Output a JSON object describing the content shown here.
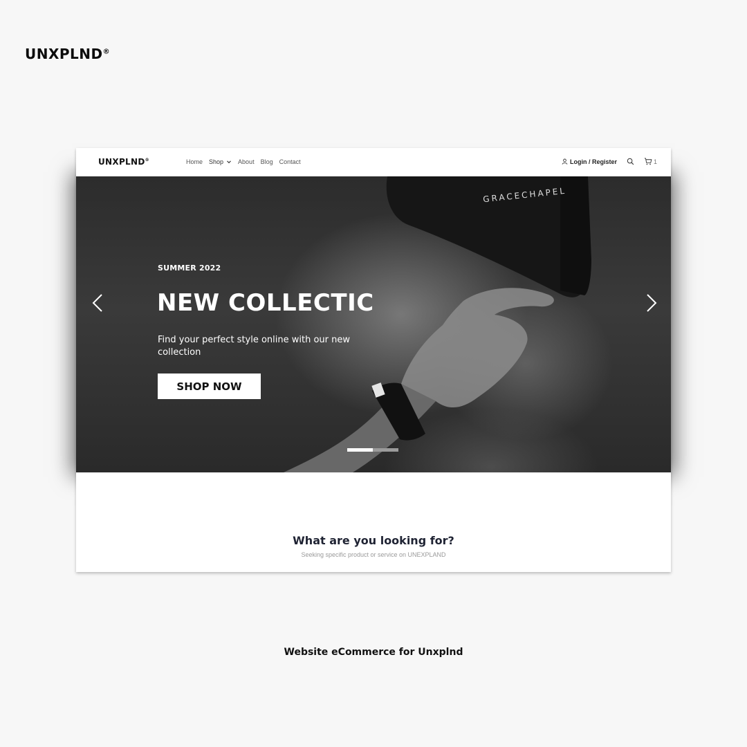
{
  "brand": {
    "name": "UNXPLND",
    "mark": "®"
  },
  "caption": "Website eCommerce for Unxplnd",
  "navbar": {
    "logo": "UNXPLND",
    "logo_mark": "®",
    "links": [
      "Home",
      "Shop",
      "About",
      "Blog",
      "Contact"
    ],
    "login_label": "Login / Register",
    "cart_count": "1",
    "icons": {
      "user": "user-icon",
      "search": "search-icon",
      "cart": "cart-icon",
      "shop_dropdown": "chevron-down-icon"
    }
  },
  "hero": {
    "eyebrow": "SUMMER 2022",
    "title": "NEW COLLECTIC",
    "subtitle": "Find your perfect style online with our new collection",
    "button_label": "SHOP NOW",
    "cap_text": "GRACECHAPEL",
    "slides_total": 2,
    "active_slide": 1,
    "icons": {
      "prev": "chevron-left-icon",
      "next": "chevron-right-icon"
    }
  },
  "lookup": {
    "title": "What are you looking for?",
    "subtitle": "Seeking specific product or service on UNEXPLAND"
  },
  "colors": {
    "background": "#f7f7f7",
    "hero_dark": "#2c2c2c",
    "heading_navy": "#1f2333"
  }
}
